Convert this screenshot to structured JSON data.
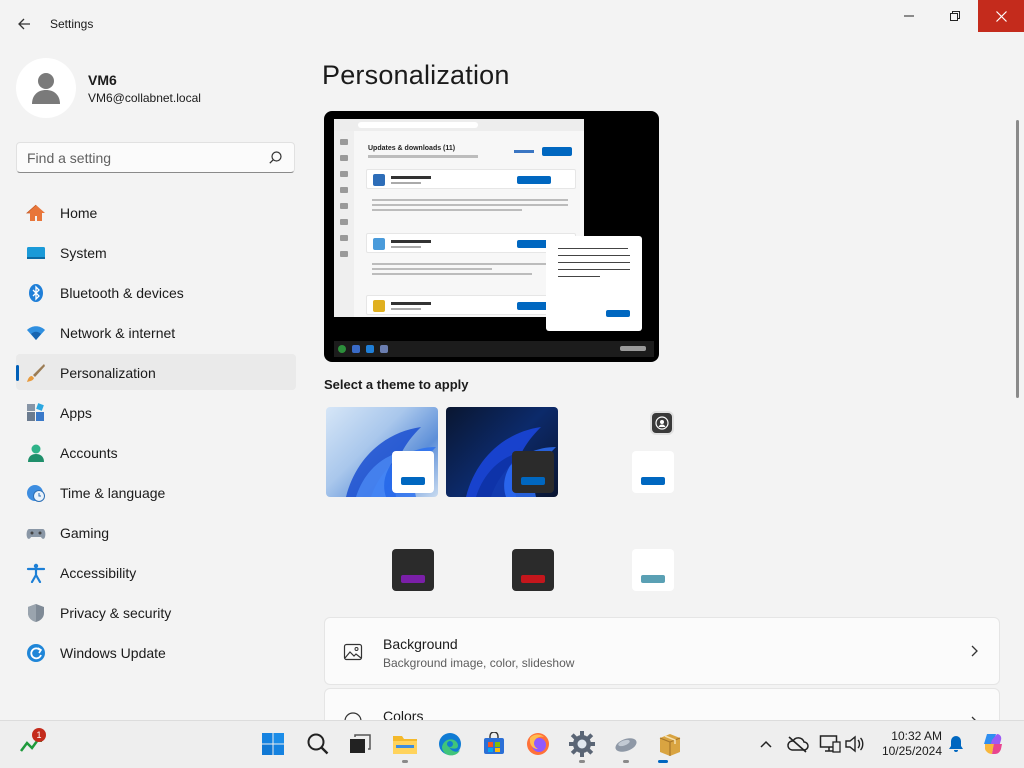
{
  "app": {
    "title": "Settings"
  },
  "profile": {
    "name": "VM6",
    "email": "VM6@collabnet.local"
  },
  "search": {
    "placeholder": "Find a setting"
  },
  "nav": {
    "items": [
      {
        "label": "Home",
        "icon": "home-icon",
        "active": false
      },
      {
        "label": "System",
        "icon": "system-icon",
        "active": false
      },
      {
        "label": "Bluetooth & devices",
        "icon": "bluetooth-icon",
        "active": false
      },
      {
        "label": "Network & internet",
        "icon": "wifi-icon",
        "active": false
      },
      {
        "label": "Personalization",
        "icon": "brush-icon",
        "active": true
      },
      {
        "label": "Apps",
        "icon": "apps-icon",
        "active": false
      },
      {
        "label": "Accounts",
        "icon": "accounts-icon",
        "active": false
      },
      {
        "label": "Time & language",
        "icon": "clock-globe-icon",
        "active": false
      },
      {
        "label": "Gaming",
        "icon": "gamepad-icon",
        "active": false
      },
      {
        "label": "Accessibility",
        "icon": "accessibility-icon",
        "active": false
      },
      {
        "label": "Privacy & security",
        "icon": "shield-icon",
        "active": false
      },
      {
        "label": "Windows Update",
        "icon": "update-icon",
        "active": false
      }
    ]
  },
  "main": {
    "title": "Personalization",
    "preview": {
      "heading": "Updates & downloads (11)"
    },
    "themes_title": "Select a theme to apply",
    "cards": [
      {
        "title": "Background",
        "subtitle": "Background image, color, slideshow",
        "icon": "image-icon"
      },
      {
        "title": "Colors",
        "subtitle": "",
        "icon": "palette-icon"
      }
    ]
  },
  "taskbar": {
    "notification_count": "1",
    "time": "10:32 AM",
    "date": "10/25/2024"
  },
  "colors": {
    "accent": "#0067c0",
    "close": "#c42b1c"
  }
}
